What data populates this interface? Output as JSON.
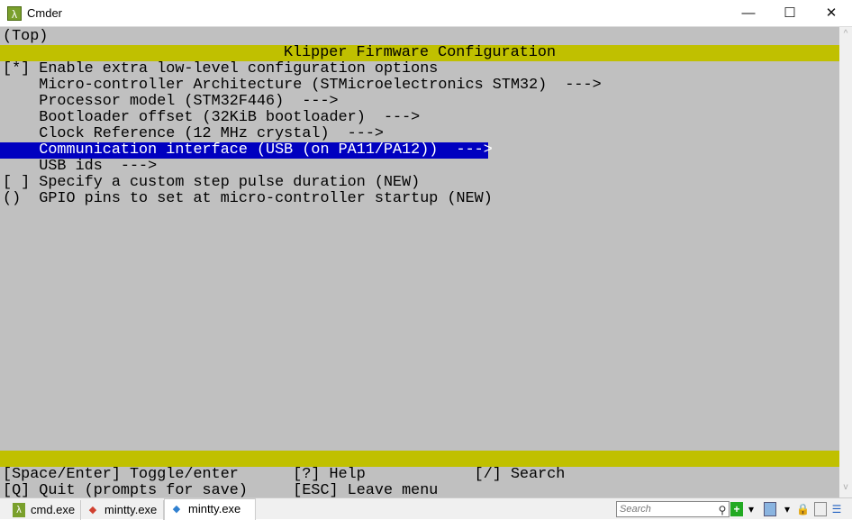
{
  "window": {
    "title": "Cmder",
    "minimize": "—",
    "maximize": "☐",
    "close": "✕",
    "app_icon": "λ"
  },
  "terminal": {
    "location": "(Top)",
    "menu_title": "Klipper Firmware Configuration",
    "items": [
      "[*] Enable extra low-level configuration options",
      "    Micro-controller Architecture (STMicroelectronics STM32)  --->",
      "    Processor model (STM32F446)  --->",
      "    Bootloader offset (32KiB bootloader)  --->",
      "    Clock Reference (12 MHz crystal)  --->",
      "    Communication interface (USB (on PA11/PA12))  --->",
      "    USB ids  --->",
      "[ ] Specify a custom step pulse duration (NEW)",
      "()  GPIO pins to set at micro-controller startup (NEW)"
    ],
    "selected_index": 5,
    "help_line1": "[Space/Enter] Toggle/enter      [?] Help            [/] Search",
    "help_line2": "[Q] Quit (prompts for save)     [ESC] Leave menu",
    "colors": {
      "background": "#c0c0c0",
      "title_bar": "#c0c000",
      "selection": "#0000c0"
    }
  },
  "tabs": [
    {
      "label": "cmd.exe",
      "icon": "λ"
    },
    {
      "label": "mintty.exe",
      "icon": "◆"
    },
    {
      "label": "mintty.exe",
      "icon": "◆",
      "active": true
    }
  ],
  "toolbar": {
    "search_placeholder": "Search",
    "new_icon": "+",
    "arrow": "▾"
  }
}
